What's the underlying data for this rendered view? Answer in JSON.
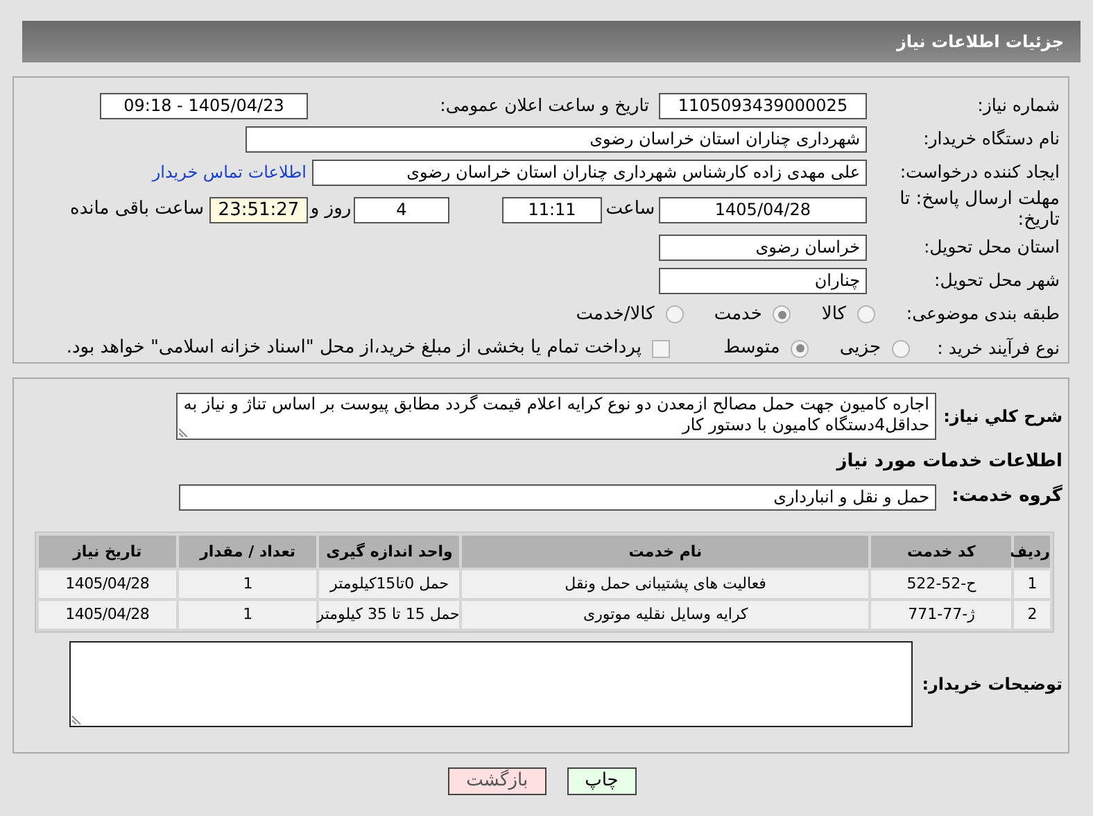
{
  "header": {
    "title": "جزئیات اطلاعات نیاز"
  },
  "need_number": {
    "label": "شماره نیاز:",
    "value": "1105093439000025"
  },
  "announce": {
    "label": "تاریخ و ساعت اعلان عمومی:",
    "value": "1405/04/23 - 09:18"
  },
  "buyer": {
    "label": "نام دستگاه خریدار:",
    "value": "شهرداری چناران استان خراسان رضوی"
  },
  "creator": {
    "label": "ایجاد کننده درخواست:",
    "value": "علی مهدی زاده کارشناس شهرداری چناران استان خراسان رضوی",
    "link": "اطلاعات تماس خریدار"
  },
  "deadline": {
    "label": "مهلت ارسال پاسخ: تا تاریخ:",
    "date": "1405/04/28",
    "time_label": "ساعت",
    "time": "11:11",
    "days": "4",
    "days_label": "روز و",
    "remaining": "23:51:27",
    "remaining_label": "ساعت باقی مانده"
  },
  "province": {
    "label": "استان محل تحویل:",
    "value": "خراسان رضوی"
  },
  "city": {
    "label": "شهر محل تحویل:",
    "value": "چناران"
  },
  "category": {
    "label": "طبقه بندی موضوعی:",
    "options": [
      {
        "label": "کالا",
        "selected": false
      },
      {
        "label": "خدمت",
        "selected": true
      },
      {
        "label": "کالا/خدمت",
        "selected": false
      }
    ]
  },
  "process": {
    "label": "نوع فرآیند خرید :",
    "options": [
      {
        "label": "جزیی",
        "selected": false
      },
      {
        "label": "متوسط",
        "selected": true
      }
    ],
    "treasury": {
      "label": "پرداخت تمام یا بخشی از مبلغ خرید،از محل \"اسناد خزانه اسلامی\" خواهد بود.",
      "checked": false
    }
  },
  "summary": {
    "label": "شرح کلي نیاز:",
    "value": "اجاره کامیون جهت حمل مصالح ازمعدن  دو نوع کرایه اعلام قیمت گردد مطابق پیوست بر اساس تناژ و نیاز به حداقل4دستگاه کامیون با دستور کار"
  },
  "services_heading": "اطلاعات خدمات مورد نیاز",
  "service_group": {
    "label": "گروه خدمت:",
    "value": "حمل و نقل و انبارداری"
  },
  "table": {
    "columns": [
      "ردیف",
      "کد خدمت",
      "نام خدمت",
      "واحد اندازه گیری",
      "تعداد / مقدار",
      "تاریخ نیاز"
    ],
    "rows": [
      [
        "1",
        "ح-52-522",
        "فعالیت های پشتیبانی حمل ونقل",
        "حمل 0تا15کیلومتر",
        "1",
        "1405/04/28"
      ],
      [
        "2",
        "ژ-77-771",
        "کرایه وسایل نقلیه موتوری",
        "حمل 15 تا 35 کیلومتر",
        "1",
        "1405/04/28"
      ]
    ]
  },
  "notes": {
    "label": "توضیحات خریدار:"
  },
  "buttons": [
    {
      "label": "چاپ",
      "kind": "print"
    },
    {
      "label": "بازگشت",
      "kind": "back"
    }
  ]
}
